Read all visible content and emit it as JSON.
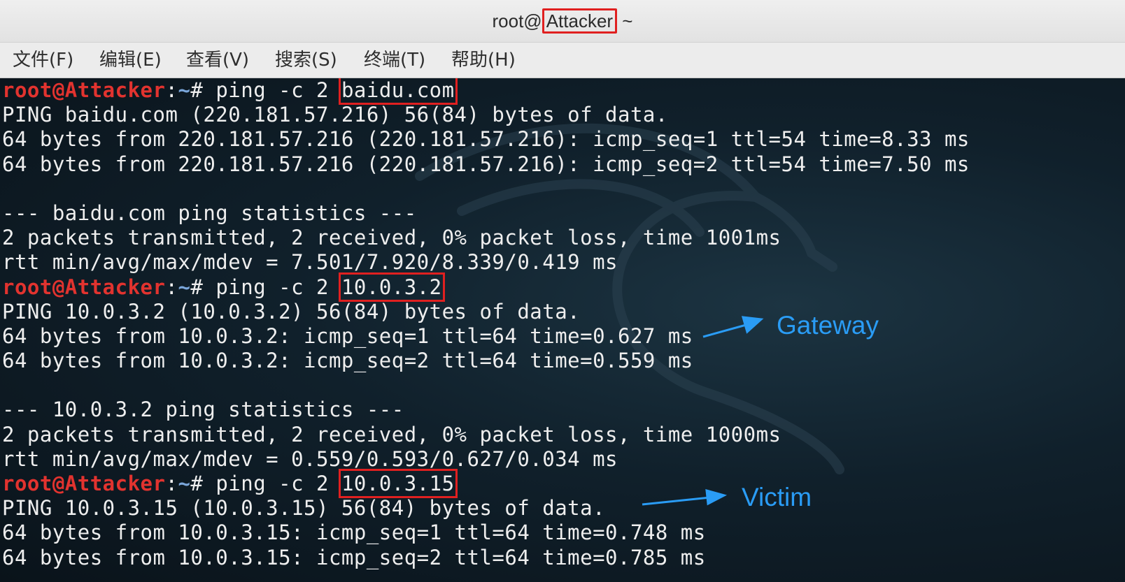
{
  "window": {
    "title_prefix": "root@",
    "title_host": "Attacker",
    "title_suffix": " ~"
  },
  "menu": {
    "items": [
      "文件(F)",
      "编辑(E)",
      "查看(V)",
      "搜索(S)",
      "终端(T)",
      "帮助(H)"
    ]
  },
  "terminal": {
    "prompt_user": "root@Attacker",
    "prompt_sep": ":",
    "prompt_path": "~",
    "prompt_tail": "# ",
    "lines": [
      {
        "type": "cmd",
        "text": "ping -c 2 ",
        "target": "baidu.com"
      },
      {
        "type": "out",
        "text": "PING baidu.com (220.181.57.216) 56(84) bytes of data."
      },
      {
        "type": "out",
        "text": "64 bytes from 220.181.57.216 (220.181.57.216): icmp_seq=1 ttl=54 time=8.33 ms"
      },
      {
        "type": "out",
        "text": "64 bytes from 220.181.57.216 (220.181.57.216): icmp_seq=2 ttl=54 time=7.50 ms"
      },
      {
        "type": "out",
        "text": ""
      },
      {
        "type": "out",
        "text": "--- baidu.com ping statistics ---"
      },
      {
        "type": "out",
        "text": "2 packets transmitted, 2 received, 0% packet loss, time 1001ms"
      },
      {
        "type": "out",
        "text": "rtt min/avg/max/mdev = 7.501/7.920/8.339/0.419 ms"
      },
      {
        "type": "cmd",
        "text": "ping -c 2 ",
        "target": "10.0.3.2"
      },
      {
        "type": "out",
        "text": "PING 10.0.3.2 (10.0.3.2) 56(84) bytes of data."
      },
      {
        "type": "out",
        "text": "64 bytes from 10.0.3.2: icmp_seq=1 ttl=64 time=0.627 ms"
      },
      {
        "type": "out",
        "text": "64 bytes from 10.0.3.2: icmp_seq=2 ttl=64 time=0.559 ms"
      },
      {
        "type": "out",
        "text": ""
      },
      {
        "type": "out",
        "text": "--- 10.0.3.2 ping statistics ---"
      },
      {
        "type": "out",
        "text": "2 packets transmitted, 2 received, 0% packet loss, time 1000ms"
      },
      {
        "type": "out",
        "text": "rtt min/avg/max/mdev = 0.559/0.593/0.627/0.034 ms"
      },
      {
        "type": "cmd",
        "text": "ping -c 2 ",
        "target": "10.0.3.15"
      },
      {
        "type": "out",
        "text": "PING 10.0.3.15 (10.0.3.15) 56(84) bytes of data."
      },
      {
        "type": "out",
        "text": "64 bytes from 10.0.3.15: icmp_seq=1 ttl=64 time=0.748 ms"
      },
      {
        "type": "out",
        "text": "64 bytes from 10.0.3.15: icmp_seq=2 ttl=64 time=0.785 ms"
      }
    ]
  },
  "annotations": {
    "gateway": "Gateway",
    "victim": "Victim"
  },
  "colors": {
    "highlight_box": "#e02020",
    "annotation": "#2a9cf5",
    "prompt_user": "#e2332f"
  }
}
